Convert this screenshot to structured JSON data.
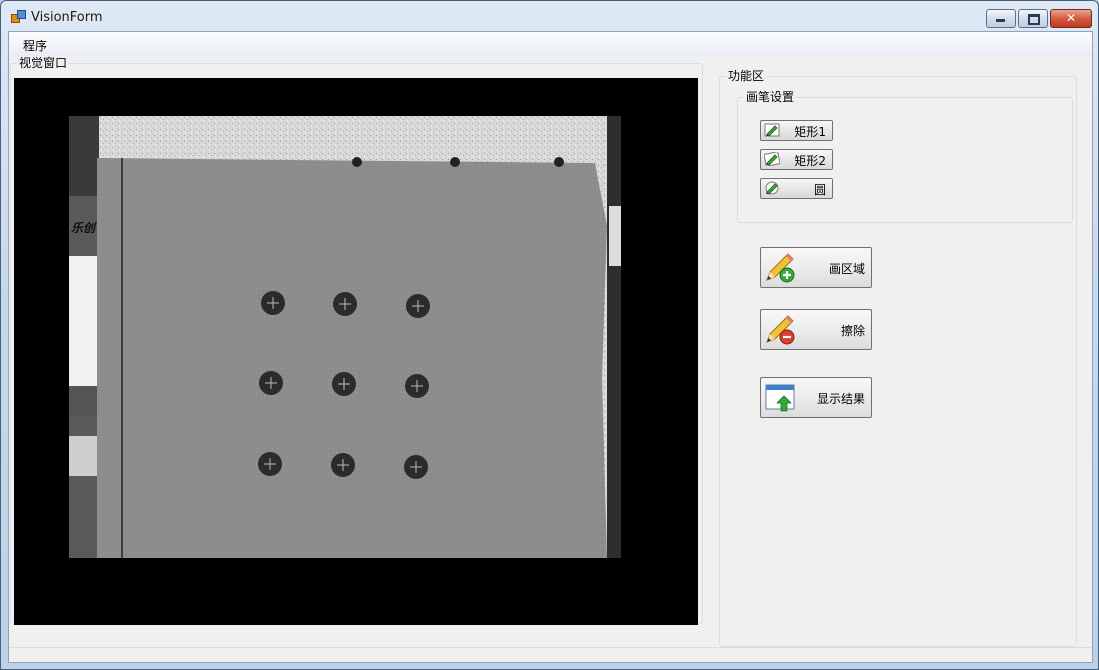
{
  "window": {
    "title": "VisionForm",
    "minimize_glyph": "",
    "close_glyph": "✕"
  },
  "menu": {
    "items": [
      {
        "label": "程序"
      }
    ]
  },
  "vision": {
    "group_title": "视觉窗口",
    "image_text": "乐创"
  },
  "functions": {
    "group_title": "功能区",
    "pen": {
      "group_title": "画笔设置",
      "buttons": [
        {
          "label": "矩形1",
          "icon": "pencil-icon"
        },
        {
          "label": "矩形2",
          "icon": "pencil-icon"
        },
        {
          "label": "圆",
          "icon": "pencil-icon"
        }
      ]
    },
    "actions": [
      {
        "label": "画区域",
        "icon": "pencil-add-icon"
      },
      {
        "label": "擦除",
        "icon": "pencil-remove-icon"
      },
      {
        "label": "显示结果",
        "icon": "show-result-icon"
      }
    ]
  },
  "colors": {
    "add_badge": "#3aa73a",
    "remove_badge": "#d9412e",
    "result_arrow": "#37a53a",
    "close_button": "#c8432a"
  }
}
